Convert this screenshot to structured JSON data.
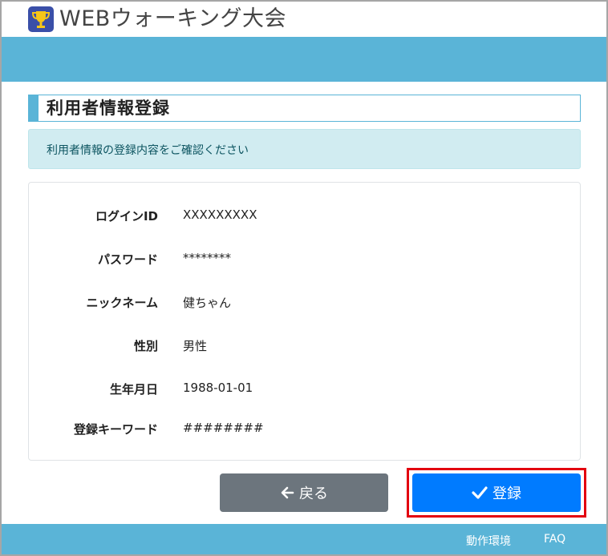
{
  "header": {
    "app_title": "WEBウォーキング大会",
    "logo_icon": "trophy-icon"
  },
  "page": {
    "section_title": "利用者情報登録",
    "notice": "利用者情報の登録内容をご確認ください"
  },
  "fields": [
    {
      "label": "ログインID",
      "value": "XXXXXXXXX"
    },
    {
      "label": "パスワード",
      "value": "********"
    },
    {
      "label": "ニックネーム",
      "value": "健ちゃん"
    },
    {
      "label": "性別",
      "value": "男性"
    },
    {
      "label": "生年月日",
      "value": "1988-01-01"
    },
    {
      "label": "登録キーワード",
      "value": "########"
    }
  ],
  "buttons": {
    "back_label": "戻る",
    "back_icon": "arrow-left-icon",
    "register_label": "登録",
    "register_icon": "check-icon"
  },
  "footer": {
    "env_link": "動作環境",
    "faq_link": "FAQ"
  },
  "colors": {
    "accent": "#5ab4d7",
    "primary_button": "#007bff",
    "secondary_button": "#6c757d",
    "notice_bg": "#d1ecf1",
    "highlight_border": "#e3000f"
  }
}
